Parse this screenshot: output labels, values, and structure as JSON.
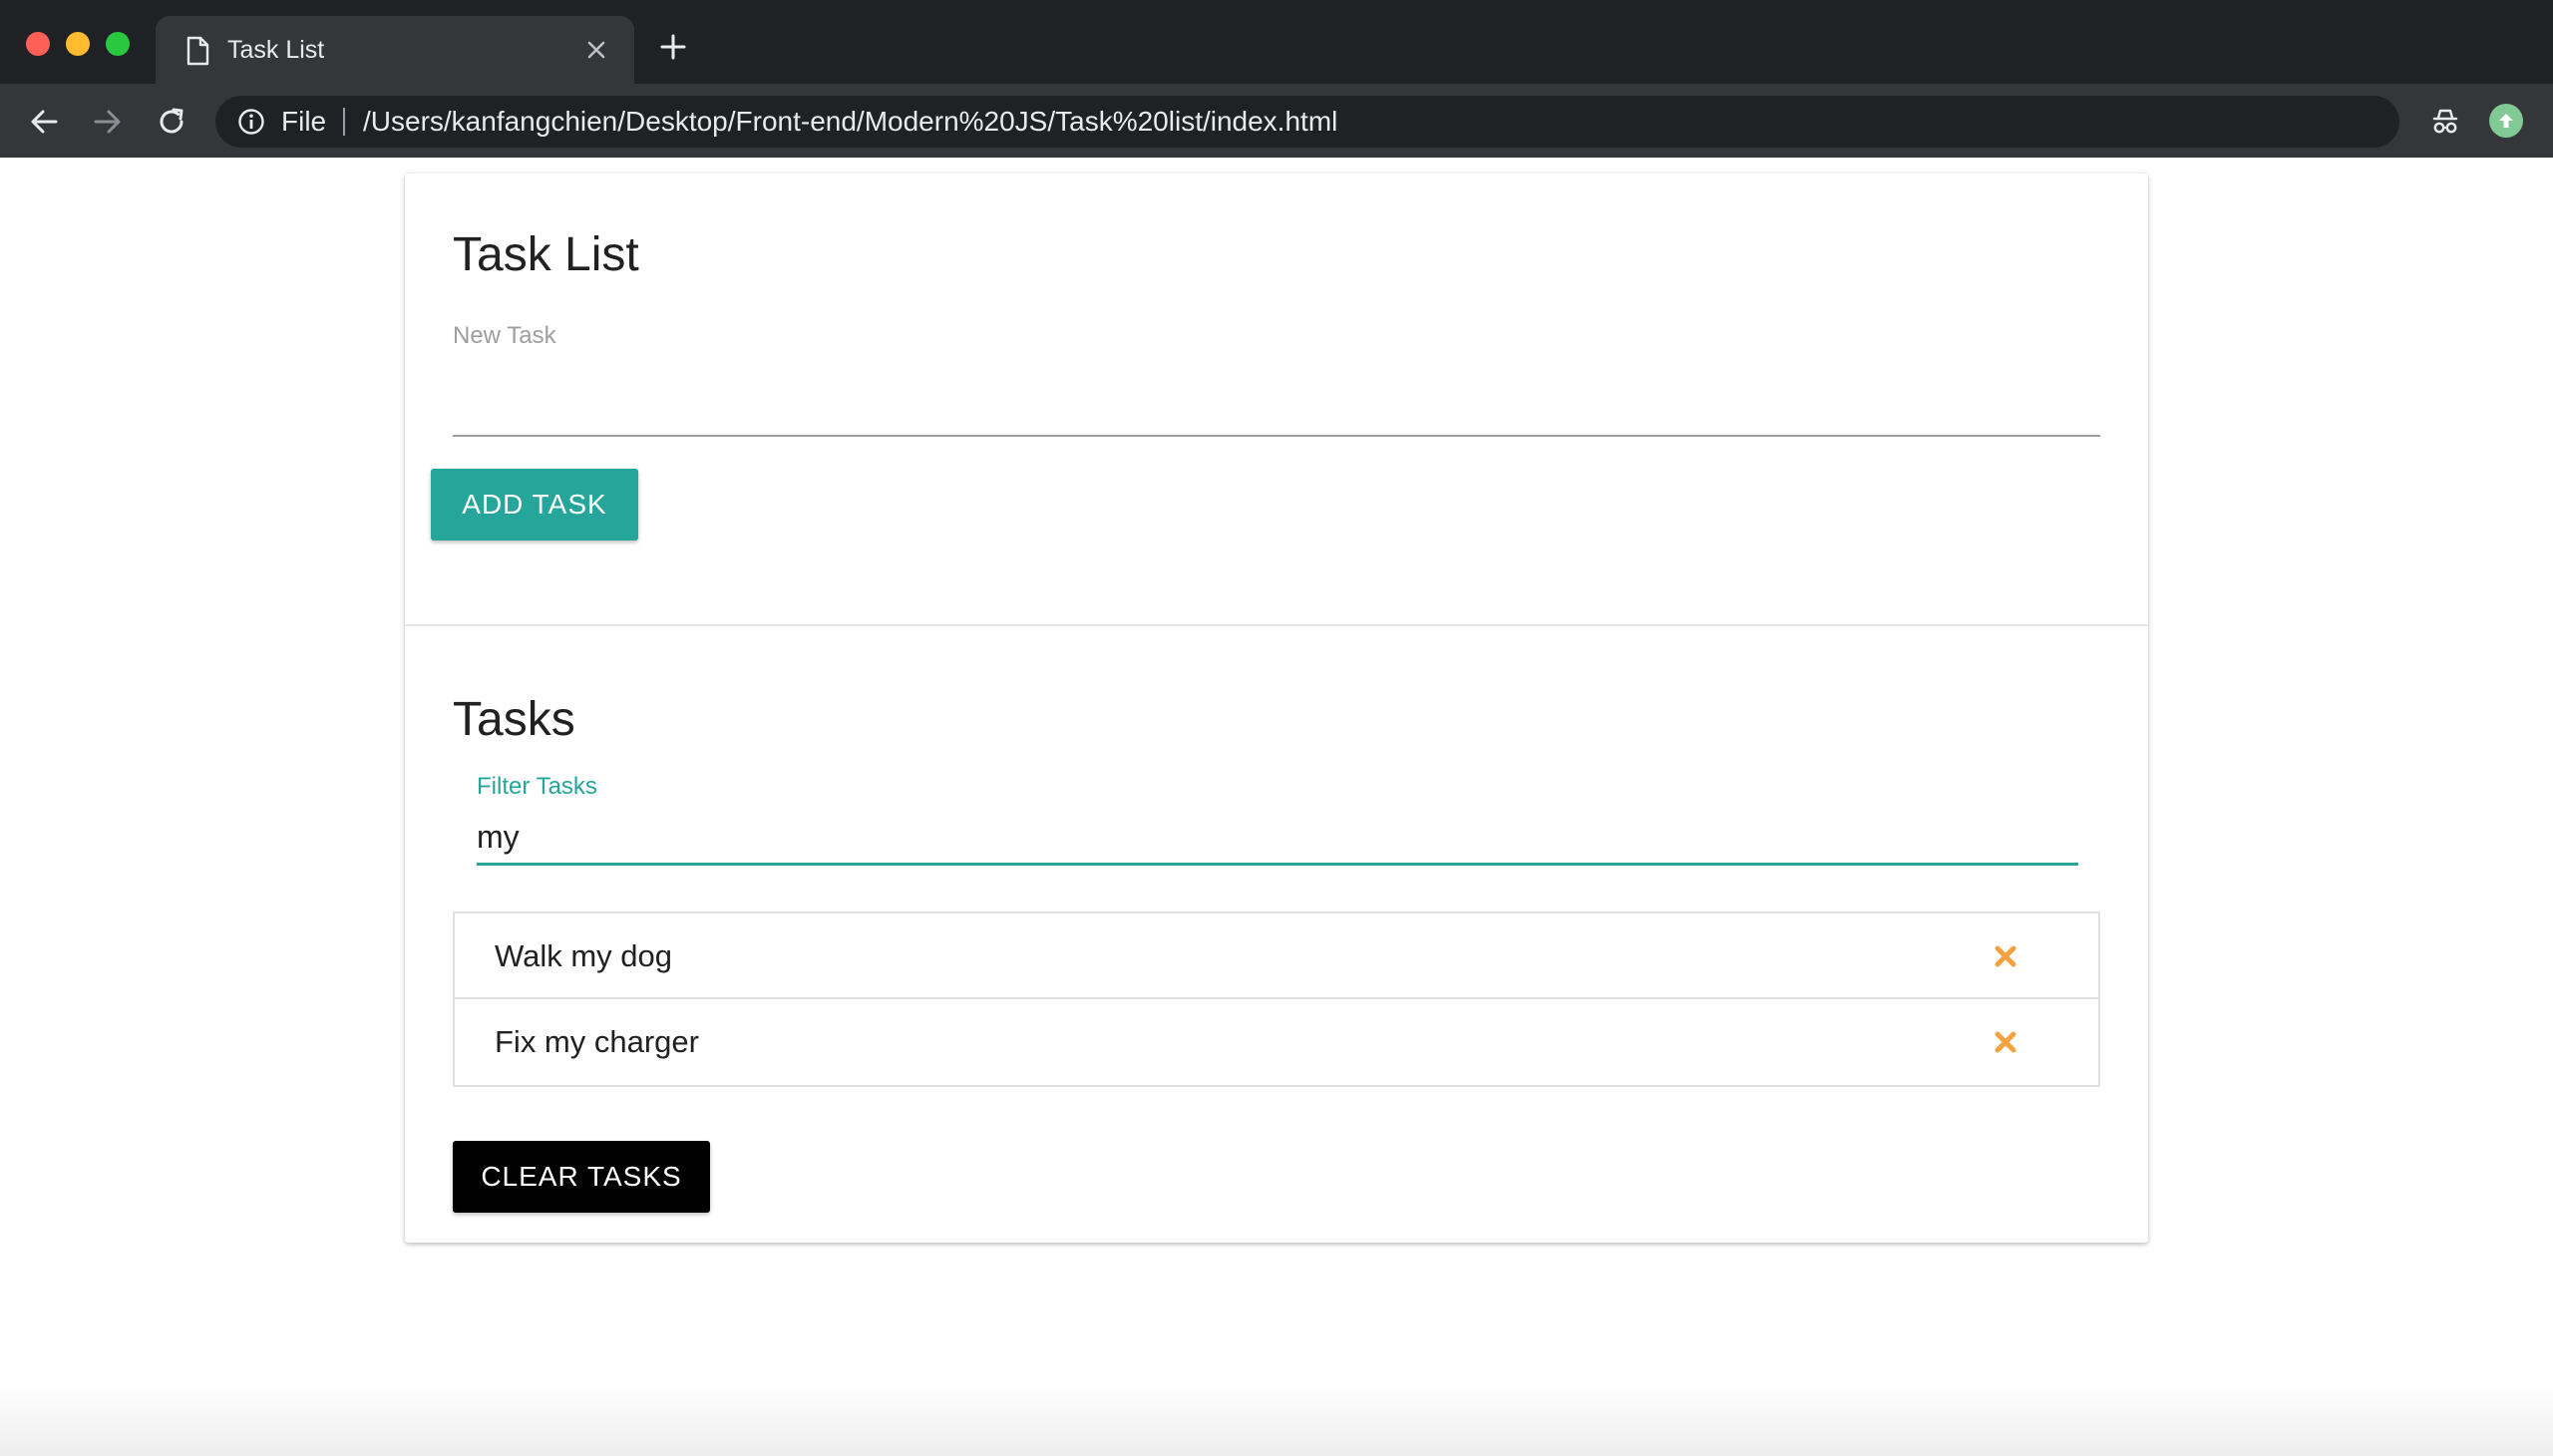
{
  "browser": {
    "tab_title": "Task List",
    "omnibox_scheme_label": "File",
    "url": "/Users/kanfangchien/Desktop/Front-end/Modern%20JS/Task%20list/index.html",
    "icons": {
      "tab_page": "page-icon",
      "tab_close": "close-icon",
      "new_tab": "plus-icon",
      "back": "arrow-left-icon",
      "forward": "arrow-right-icon",
      "reload": "reload-icon",
      "info": "info-icon",
      "bookmark": "star-icon",
      "extension": "incognito-icon",
      "update": "update-arrow-icon"
    }
  },
  "app": {
    "title": "Task List",
    "new_task_label": "New Task",
    "new_task_value": "",
    "add_task_label": "ADD TASK",
    "tasks_title": "Tasks",
    "filter_label": "Filter Tasks",
    "filter_value": "my",
    "tasks": [
      {
        "text": "Walk my dog"
      },
      {
        "text": "Fix my charger"
      }
    ],
    "clear_tasks_label": "CLEAR TASKS",
    "colors": {
      "accent": "#26a69a",
      "delete_icon": "#f4a142",
      "clear_button": "#000000"
    }
  }
}
